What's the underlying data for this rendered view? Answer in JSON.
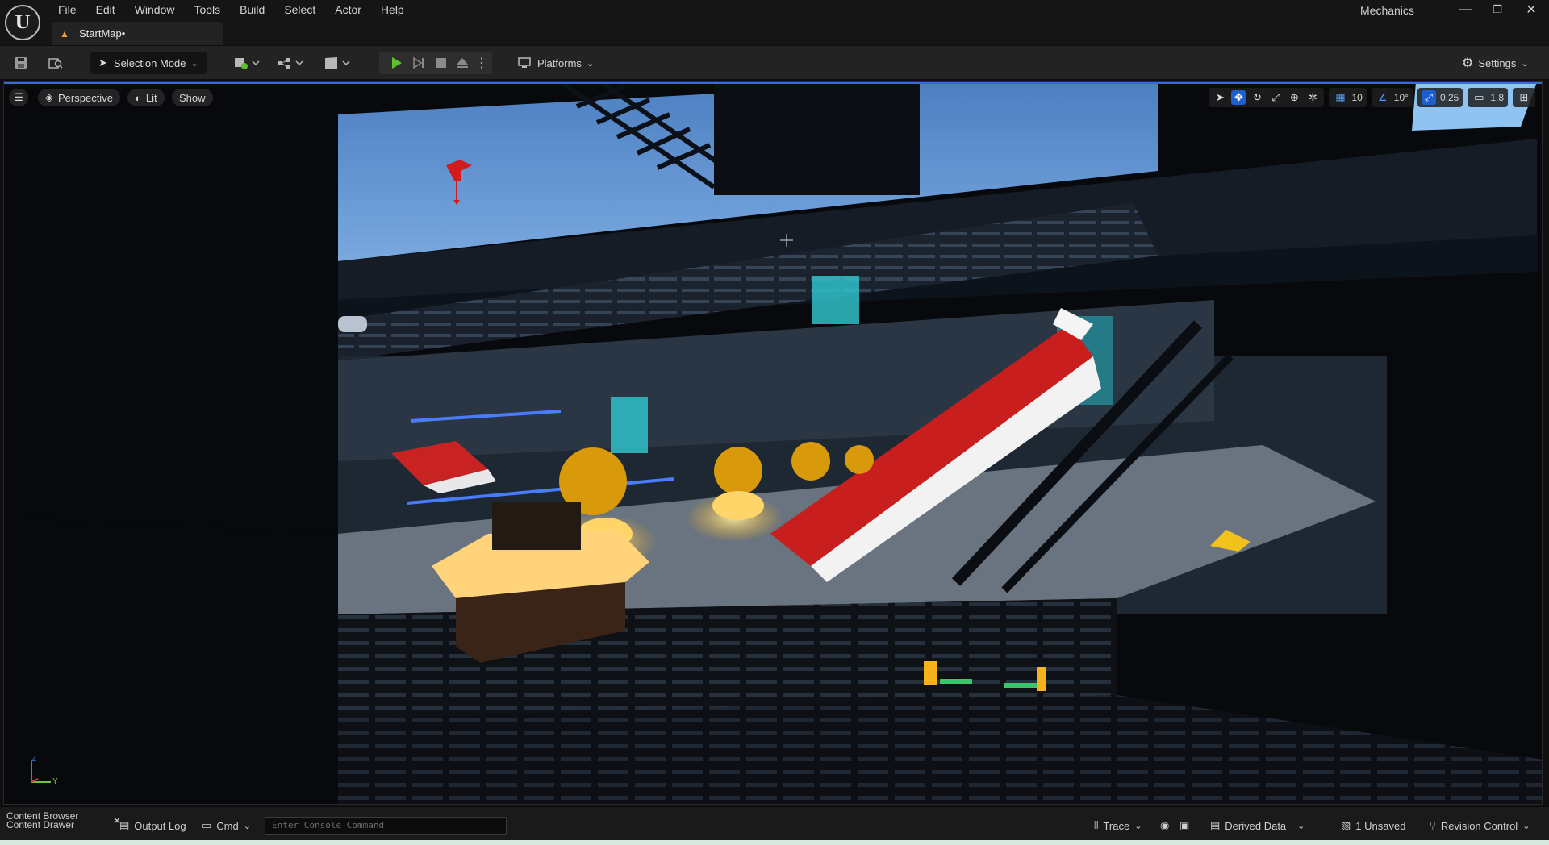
{
  "app": {
    "logo_text": "U",
    "project_name": "Mechanics"
  },
  "menu": [
    "File",
    "Edit",
    "Window",
    "Tools",
    "Build",
    "Select",
    "Actor",
    "Help"
  ],
  "tabs": [
    {
      "label": "StartMap•"
    }
  ],
  "window_controls": {
    "minimize": "—",
    "restore": "❐",
    "close": "✕"
  },
  "toolbar": {
    "selection_mode": "Selection Mode",
    "platforms": "Platforms",
    "settings": "Settings"
  },
  "viewport": {
    "view_mode": "Perspective",
    "lighting": "Lit",
    "show": "Show",
    "grid_snap": "10",
    "rotation_snap": "10°",
    "scale_snap": "0.25",
    "camera_speed": "1.8",
    "axis_z": "Z",
    "axis_y": "Y"
  },
  "statusbar": {
    "content_browser": "Content Browser",
    "content_drawer": "Content Drawer",
    "output_log": "Output Log",
    "cmd": "Cmd",
    "console_placeholder": "Enter Console Command",
    "trace": "Trace",
    "derived_data": "Derived Data",
    "unsaved": "1 Unsaved",
    "revision_control": "Revision Control"
  },
  "colors": {
    "accent_blue": "#2f6fd6",
    "play_green": "#5fbf2f",
    "warning_orange": "#e6a23c"
  }
}
